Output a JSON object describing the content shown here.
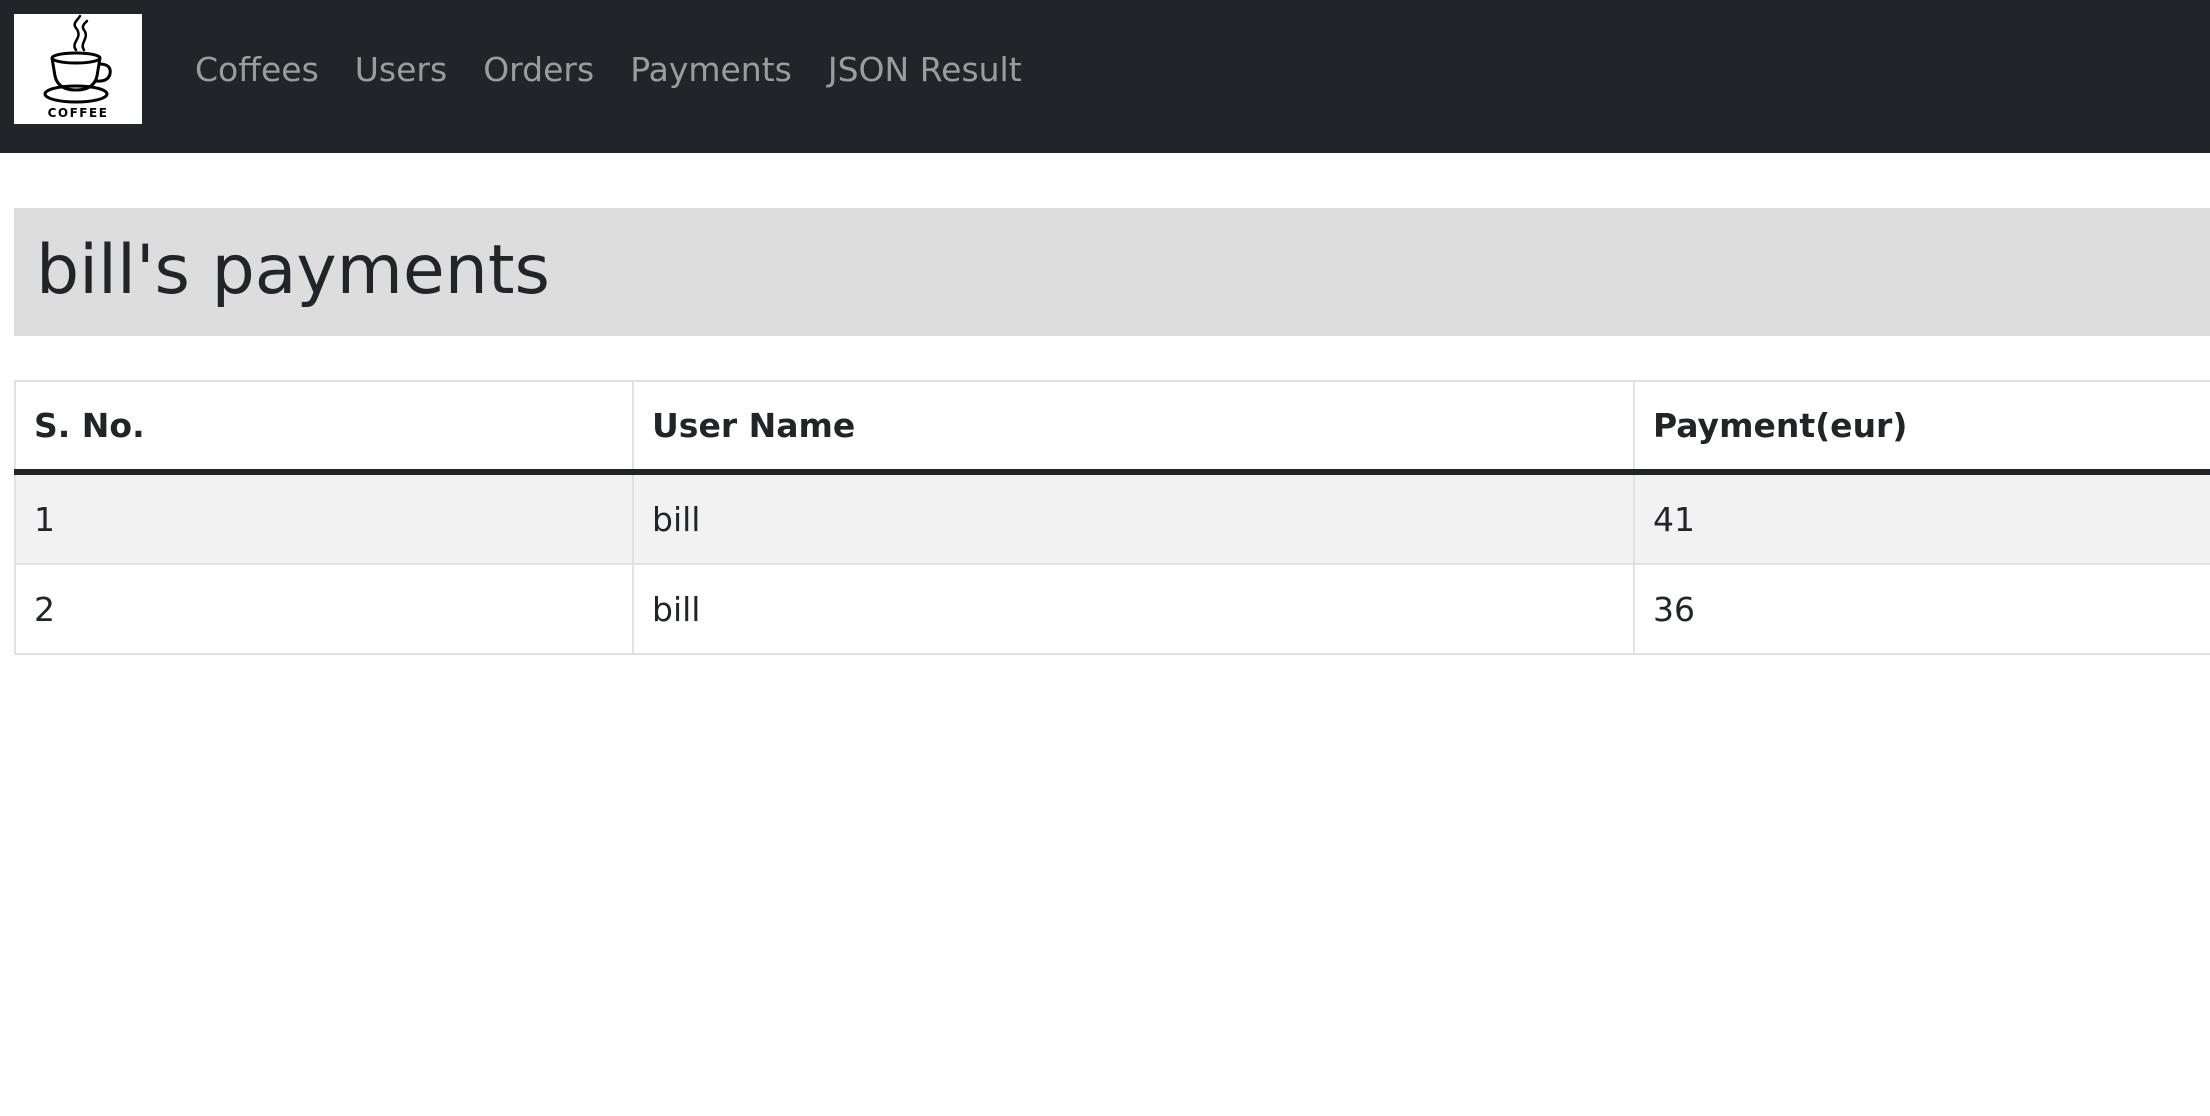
{
  "navbar": {
    "logo": {
      "icon": "coffee-cup-icon",
      "text": "COFFEE"
    },
    "links": [
      "Coffees",
      "Users",
      "Orders",
      "Payments",
      "JSON Result"
    ]
  },
  "page": {
    "title": "bill's payments"
  },
  "table": {
    "headers": [
      "S. No.",
      "User Name",
      "Payment(eur)"
    ],
    "rows": [
      [
        "1",
        "bill",
        "41"
      ],
      [
        "2",
        "bill",
        "36"
      ]
    ]
  },
  "colors": {
    "navbar_bg": "#212529",
    "header_bg": "#dddddd",
    "stripe_bg": "#f2f2f2"
  }
}
